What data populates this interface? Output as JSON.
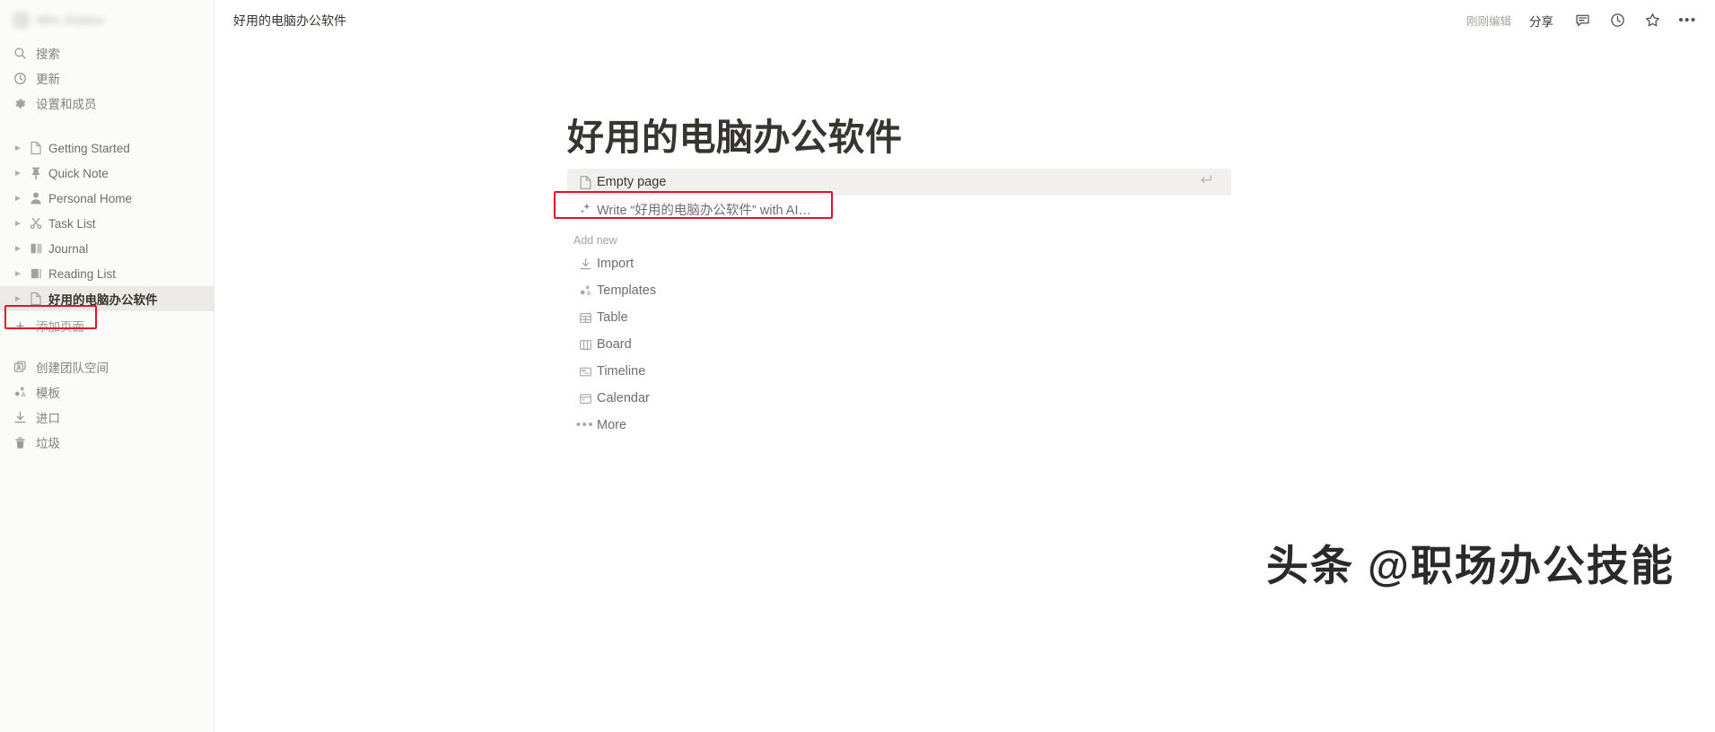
{
  "sidebar": {
    "workspace": {
      "name": "Win Status",
      "caret": "⌄"
    },
    "nav": [
      {
        "label": "搜索",
        "icon": "search-icon"
      },
      {
        "label": "更新",
        "icon": "clock-update-icon"
      },
      {
        "label": "设置和成员",
        "icon": "gear-icon"
      }
    ],
    "pages": [
      {
        "label": "Getting Started",
        "icon": "document-icon",
        "selected": false
      },
      {
        "label": "Quick Note",
        "icon": "pin-icon",
        "selected": false
      },
      {
        "label": "Personal Home",
        "icon": "person-icon",
        "selected": false
      },
      {
        "label": "Task List",
        "icon": "scissors-icon",
        "selected": false
      },
      {
        "label": "Journal",
        "icon": "book-icon",
        "selected": false
      },
      {
        "label": "Reading List",
        "icon": "books-icon",
        "selected": false
      },
      {
        "label": "好用的电脑办公软件",
        "icon": "document-icon",
        "selected": true
      }
    ],
    "add_page": {
      "label": "添加页面",
      "icon": "plus-icon",
      "highlighted": true
    },
    "bottom": [
      {
        "label": "创建团队空间",
        "icon": "teamspace-icon"
      },
      {
        "label": "模板",
        "icon": "templates-icon"
      },
      {
        "label": "进口",
        "icon": "import-icon"
      },
      {
        "label": "垃圾",
        "icon": "trash-icon"
      }
    ]
  },
  "topbar": {
    "breadcrumb": "好用的电脑办公软件",
    "edited": "刚刚编辑",
    "share": "分享",
    "icons": [
      "comment-icon",
      "history-clock-icon",
      "star-icon",
      "more-dots-icon"
    ]
  },
  "page": {
    "title": "好用的电脑办公软件",
    "menu_primary": [
      {
        "label": "Empty page",
        "icon": "document-icon",
        "active": true,
        "enter_hint": "↵"
      },
      {
        "label": "Write “好用的电脑办公软件” with AI…",
        "icon": "ai-sparkle-icon",
        "active": false,
        "highlighted": true
      }
    ],
    "add_new_label": "Add new",
    "menu_add_new": [
      {
        "label": "Import",
        "icon": "import-icon"
      },
      {
        "label": "Templates",
        "icon": "templates-icon"
      },
      {
        "label": "Table",
        "icon": "table-icon"
      },
      {
        "label": "Board",
        "icon": "board-icon"
      },
      {
        "label": "Timeline",
        "icon": "timeline-icon"
      },
      {
        "label": "Calendar",
        "icon": "calendar-icon"
      },
      {
        "label": "More",
        "icon": "more-dots-icon"
      }
    ]
  },
  "watermark": {
    "text": "头条 @职场办公技能"
  },
  "colors": {
    "highlight_red": "#e8112d",
    "row_active_bg": "#f1f0ee",
    "sidebar_bg": "#fbfbfa",
    "text_primary": "#37352f",
    "text_muted": "#9b9a97",
    "ai_purple": "#9b72cf"
  }
}
